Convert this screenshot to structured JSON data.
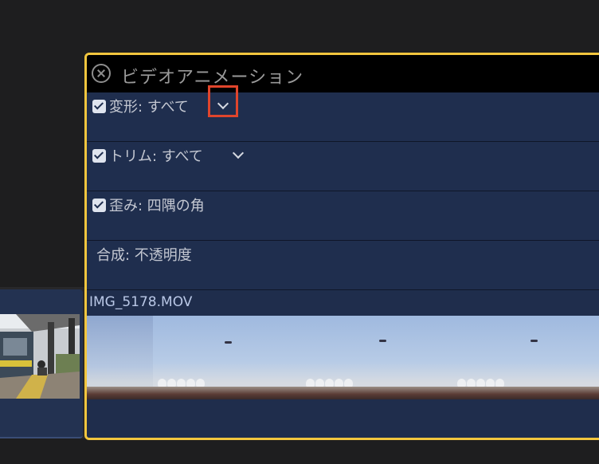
{
  "panel": {
    "title": "ビデオアニメーション",
    "rows": [
      {
        "label": "変形: すべて",
        "checked": true,
        "has_menu": true
      },
      {
        "label": "トリム: すべて",
        "checked": true,
        "has_menu": true
      },
      {
        "label": "歪み: 四隅の角",
        "checked": true,
        "has_menu": false
      },
      {
        "label": "合成: 不透明度",
        "checked": false,
        "has_menu": false
      }
    ]
  },
  "clip": {
    "name": "IMG_5178.MOV"
  },
  "colors": {
    "panel_border": "#f2c63e",
    "highlight": "#e0452c",
    "clip_bg": "#1f2d4c"
  }
}
